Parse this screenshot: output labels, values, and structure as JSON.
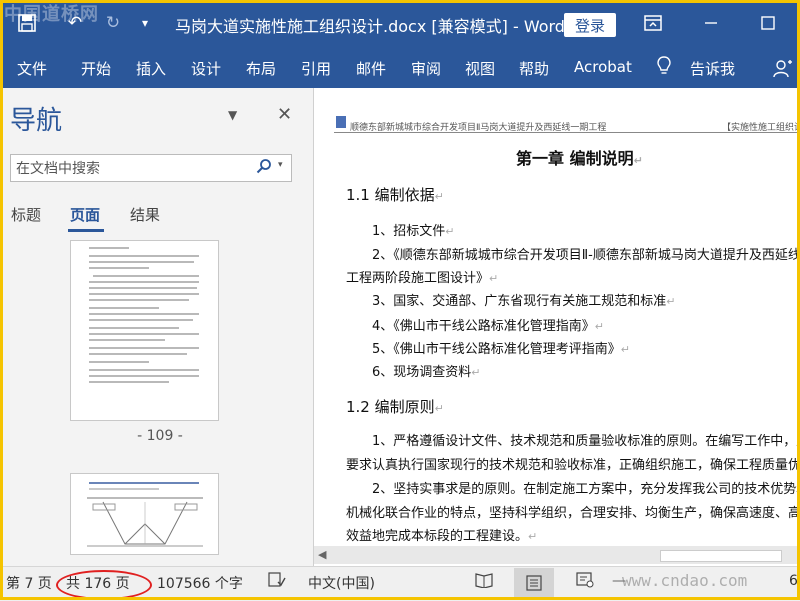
{
  "watermark_top": "中国道桥网",
  "titlebar": {
    "title": "马岗大道实施性施工组织设计.docx [兼容模式] - Word",
    "login_label": "登录"
  },
  "ribbon_tabs": [
    "文件",
    "开始",
    "插入",
    "设计",
    "布局",
    "引用",
    "邮件",
    "审阅",
    "视图",
    "帮助",
    "Acrobat",
    "告诉我"
  ],
  "nav": {
    "title": "导航",
    "search_placeholder": "在文档中搜索",
    "tabs": [
      "标题",
      "页面",
      "结果"
    ],
    "active_tab": "页面",
    "page_label": "- 109 -"
  },
  "document": {
    "header_left": "顺德东部新城城市综合开发项目Ⅱ马岗大道提升及西延线一期工程",
    "header_right": "【实施性施工组织设",
    "chapter": "第一章   编制说明",
    "sec1": "1.1   编制依据",
    "items": [
      "1、招标文件",
      "2、《顺德东部新城城市综合开发项目Ⅱ-顺德东部新城马岗大道提升及西延线一",
      "工程两阶段施工图设计》",
      "3、国家、交通部、广东省现行有关施工规范和标准",
      "4、《佛山市干线公路标准化管理指南》",
      "5、《佛山市干线公路标准化管理考评指南》",
      "6、现场调查资料"
    ],
    "sec2": "1.2   编制原则",
    "para": [
      "1、严格遵循设计文件、技术规范和质量验收标准的原则。在编写工作中，严格按设",
      "要求认真执行国家现行的技术规范和验收标准，正确组织施工，确保工程质量优良",
      "2、坚持实事求是的原则。在制定施工方案中，充分发挥我公司的技术优势和专业化",
      "机械化联合作业的特点，坚持科学组织，合理安排、均衡生产，确保高速度、高质量、",
      "效益地完成本标段的工程建设。"
    ]
  },
  "status": {
    "page": "第 7 页",
    "total": "共 176 页",
    "words": "107566 个字",
    "language": "中文(中国)",
    "zoom_fragment": "6"
  },
  "watermark_bottom": "www.cndao.com",
  "colors": {
    "word_blue": "#2b579a",
    "highlight_oval": "#e02020",
    "frame": "#f5c400"
  }
}
